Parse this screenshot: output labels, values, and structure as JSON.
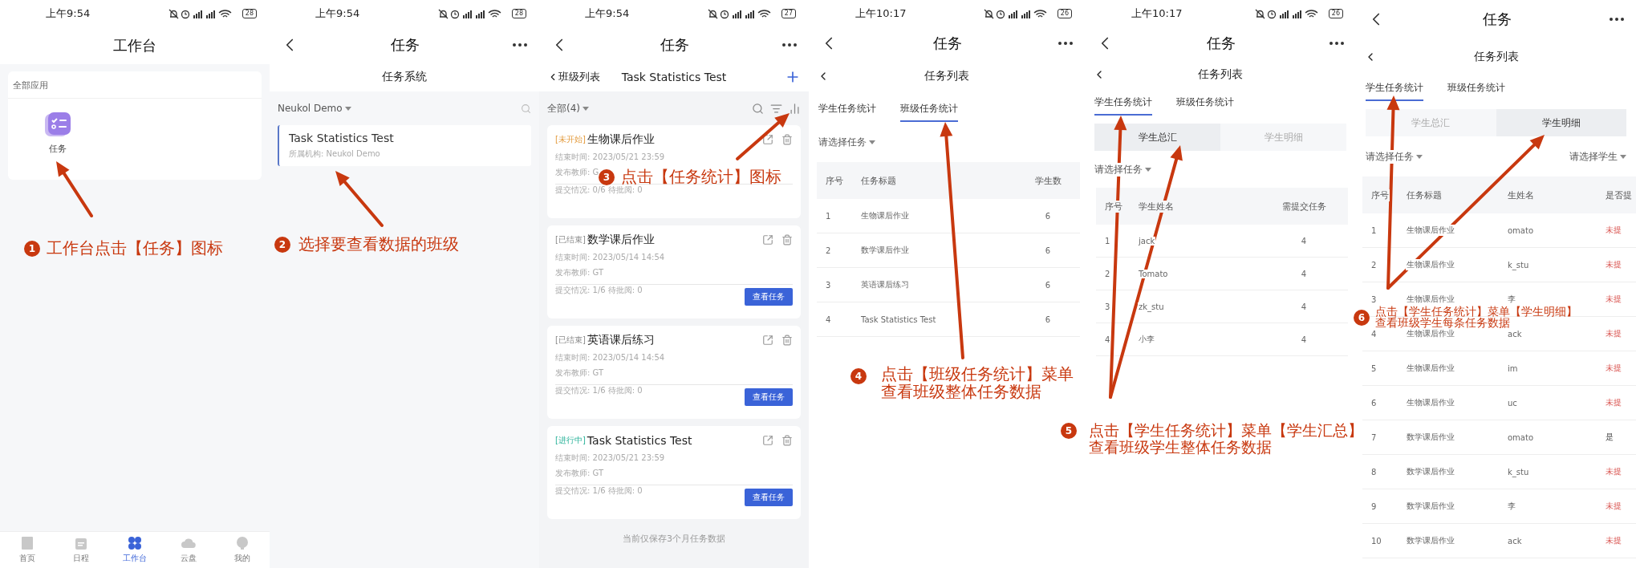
{
  "screens": [
    {
      "kind": "workbench",
      "status": {
        "time": "上午9:54",
        "battery": "28"
      },
      "title": "工作台",
      "section": "全部应用",
      "apps": [
        {
          "label": "任务"
        }
      ],
      "tabbar": [
        {
          "label": "首页",
          "selected": false
        },
        {
          "label": "日程",
          "selected": false
        },
        {
          "label": "工作台",
          "selected": true
        },
        {
          "label": "云盘",
          "selected": false
        },
        {
          "label": "我的",
          "selected": false
        }
      ]
    },
    {
      "kind": "class_list",
      "status": {
        "time": "上午9:54",
        "battery": "28"
      },
      "title": "任务",
      "subtitle": "任务系统",
      "org_filter": "Neukol Demo",
      "classes": [
        {
          "name": "Task Statistics Test",
          "org": "所属机构: Neukol Demo"
        }
      ]
    },
    {
      "kind": "task_list",
      "status": {
        "time": "上午9:54",
        "battery": "27"
      },
      "title": "任务",
      "back_label": "班级列表",
      "subtitle": "Task Statistics Test",
      "filter": "全部(4)",
      "tasks": [
        {
          "tag": "[未开始]",
          "color": "#e39a3b",
          "title": "生物课后作业",
          "end": "结束时间: 2023/05/21 23:59",
          "teacher": "发布教师: G",
          "progress": "提交情况: 0/6 待批阅: 0"
        },
        {
          "tag": "[已结束]",
          "color": "#8a8a8a",
          "title": "数学课后作业",
          "end": "结束时间: 2023/05/14 14:54",
          "teacher": "发布教师: GT",
          "progress": "提交情况: 1/6 待批阅: 0",
          "button": "查看任务"
        },
        {
          "tag": "[已结束]",
          "color": "#8a8a8a",
          "title": "英语课后练习",
          "end": "结束时间: 2023/05/14 14:54",
          "teacher": "发布教师: GT",
          "progress": "提交情况: 1/6 待批阅: 0",
          "button": "查看任务"
        },
        {
          "tag": "[进行中]",
          "color": "#2bb39a",
          "title": "Task Statistics Test",
          "end": "结束时间: 2023/05/21 23:59",
          "teacher": "发布教师: GT",
          "progress": "提交情况: 1/6 待批阅: 0",
          "button": "查看任务"
        }
      ],
      "footer": "当前仅保存3个月任务数据"
    },
    {
      "kind": "class_stats",
      "status": {
        "time": "上午10:17",
        "battery": "26"
      },
      "title": "任务",
      "subtitle": "任务列表",
      "tabs": [
        {
          "label": "学生任务统计",
          "selected": false
        },
        {
          "label": "班级任务统计",
          "selected": true
        }
      ],
      "task_select": "请选择任务",
      "columns": [
        "序号",
        "任务标题",
        "学生数"
      ],
      "rows": [
        [
          "1",
          "生物课后作业",
          "6"
        ],
        [
          "2",
          "数学课后作业",
          "6"
        ],
        [
          "3",
          "英语课后练习",
          "6"
        ],
        [
          "4",
          "Task Statistics Test",
          "6"
        ]
      ]
    },
    {
      "kind": "student_summary",
      "status": {
        "time": "上午10:17",
        "battery": "26"
      },
      "title": "任务",
      "subtitle": "任务列表",
      "tabs": [
        {
          "label": "学生任务统计",
          "selected": true
        },
        {
          "label": "班级任务统计",
          "selected": false
        }
      ],
      "segments": [
        {
          "label": "学生总汇",
          "selected": true
        },
        {
          "label": "学生明细",
          "selected": false
        }
      ],
      "task_select": "请选择任务",
      "columns": [
        "序号",
        "学生姓名",
        "需提交任务"
      ],
      "rows": [
        [
          "1",
          "jack",
          "4"
        ],
        [
          "2",
          "Tomato",
          "4"
        ],
        [
          "3",
          "zk_stu",
          "4"
        ],
        [
          "4",
          "小李",
          "4"
        ]
      ]
    },
    {
      "kind": "student_detail",
      "title": "任务",
      "subtitle": "任务列表",
      "tabs": [
        {
          "label": "学生任务统计",
          "selected": true
        },
        {
          "label": "班级任务统计",
          "selected": false
        }
      ],
      "segments": [
        {
          "label": "学生总汇",
          "selected": false
        },
        {
          "label": "学生明细",
          "selected": true
        }
      ],
      "task_select": "请选择任务",
      "student_select": "请选择学生",
      "columns": [
        "序号",
        "任务标题",
        "生姓名",
        "是否提"
      ],
      "rows": [
        {
          "cells": [
            "1",
            "生物课后作业",
            "omato",
            "未提"
          ],
          "submitted": false
        },
        {
          "cells": [
            "2",
            "生物课后作业",
            "k_stu",
            "未提"
          ],
          "submitted": false
        },
        {
          "cells": [
            "3",
            "生物课后作业",
            "李",
            "未提"
          ],
          "submitted": false
        },
        {
          "cells": [
            "4",
            "生物课后作业",
            "ack",
            "未提"
          ],
          "submitted": false
        },
        {
          "cells": [
            "5",
            "生物课后作业",
            "im",
            "未提"
          ],
          "submitted": false
        },
        {
          "cells": [
            "6",
            "生物课后作业",
            "uc",
            "未提"
          ],
          "submitted": false
        },
        {
          "cells": [
            "7",
            "数学课后作业",
            "omato",
            "是"
          ],
          "submitted": true
        },
        {
          "cells": [
            "8",
            "数学课后作业",
            "k_stu",
            "未提"
          ],
          "submitted": false
        },
        {
          "cells": [
            "9",
            "数学课后作业",
            "李",
            "未提"
          ],
          "submitted": false
        },
        {
          "cells": [
            "10",
            "数学课后作业",
            "ack",
            "未提"
          ],
          "submitted": false
        }
      ]
    }
  ],
  "annotations": [
    {
      "step": "1",
      "lines": [
        "工作台点击【任务】图标"
      ]
    },
    {
      "step": "2",
      "lines": [
        "选择要查看数据的班级"
      ]
    },
    {
      "step": "3",
      "lines": [
        "点击【任务统计】图标"
      ]
    },
    {
      "step": "4",
      "lines": [
        "点击【班级任务统计】菜单",
        "查看班级整体任务数据"
      ]
    },
    {
      "step": "5",
      "lines": [
        "点击【学生任务统计】菜单【学生汇总】",
        "查看班级学生整体任务数据"
      ]
    },
    {
      "step": "6",
      "lines": [
        "点击【学生任务统计】菜单【学生明细】",
        "查看班级学生每条任务数据"
      ]
    }
  ]
}
